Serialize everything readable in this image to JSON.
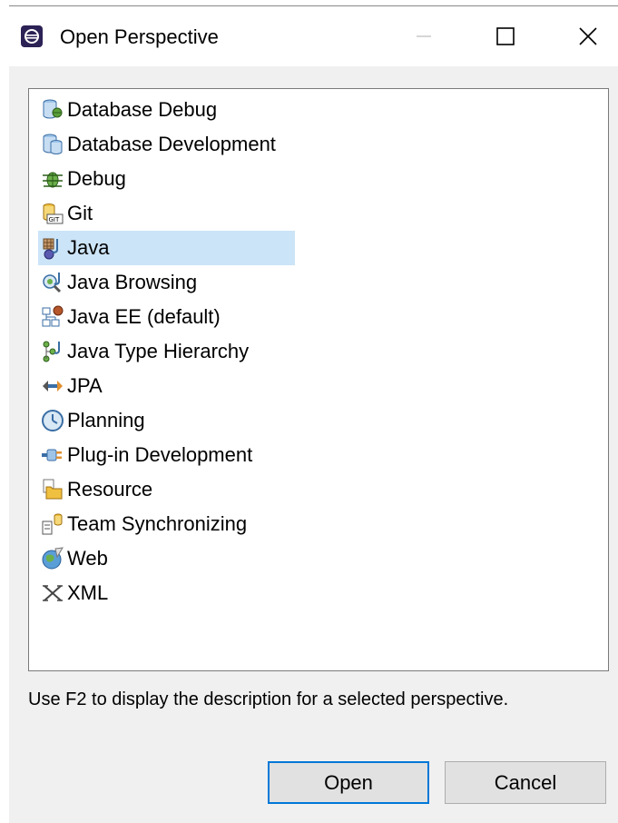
{
  "window": {
    "title": "Open Perspective",
    "minimize_label": "—",
    "maximize_label": "☐",
    "close_label": "✕"
  },
  "perspectives": [
    {
      "label": "Database Debug",
      "icon": "database-debug-icon"
    },
    {
      "label": "Database Development",
      "icon": "database-icon"
    },
    {
      "label": "Debug",
      "icon": "bug-icon"
    },
    {
      "label": "Git",
      "icon": "git-icon"
    },
    {
      "label": "Java",
      "icon": "java-icon",
      "selected": true
    },
    {
      "label": "Java Browsing",
      "icon": "java-browsing-icon"
    },
    {
      "label": "Java EE (default)",
      "icon": "java-ee-icon"
    },
    {
      "label": "Java Type Hierarchy",
      "icon": "hierarchy-icon"
    },
    {
      "label": "JPA",
      "icon": "jpa-icon"
    },
    {
      "label": "Planning",
      "icon": "planning-icon"
    },
    {
      "label": "Plug-in Development",
      "icon": "plugin-icon"
    },
    {
      "label": "Resource",
      "icon": "resource-folder-icon"
    },
    {
      "label": "Team Synchronizing",
      "icon": "team-sync-icon"
    },
    {
      "label": "Web",
      "icon": "web-globe-icon"
    },
    {
      "label": "XML",
      "icon": "xml-icon"
    }
  ],
  "hint": "Use F2 to display the description for a selected perspective.",
  "buttons": {
    "open": "Open",
    "cancel": "Cancel"
  },
  "colors": {
    "selection": "#cce4f7",
    "highlight": "#ecf72a",
    "default_button_border": "#0078d7"
  }
}
